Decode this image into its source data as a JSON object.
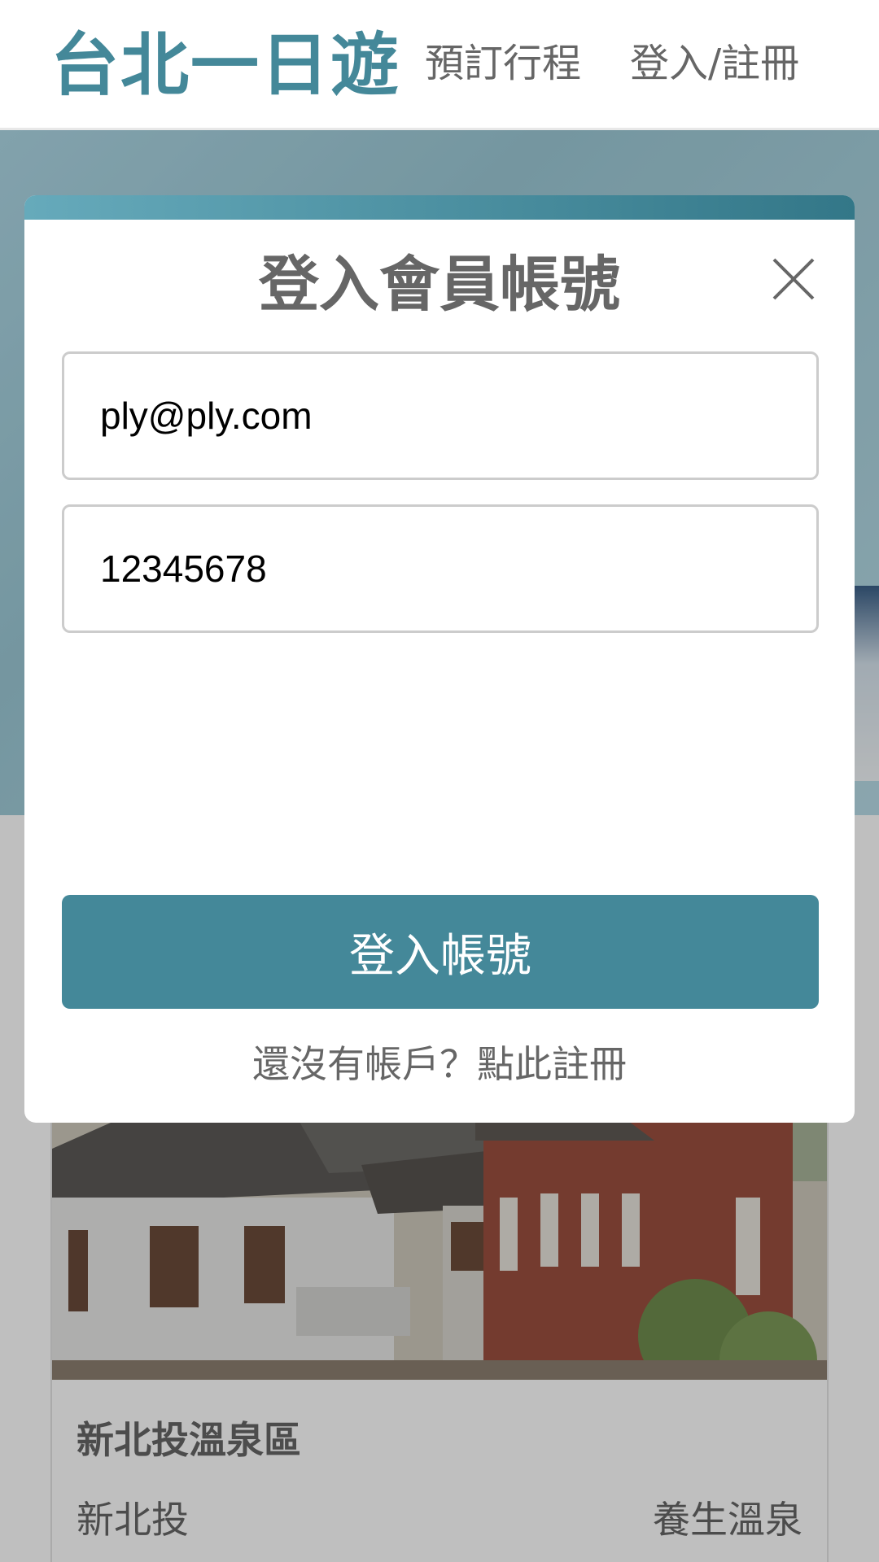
{
  "header": {
    "logo": "台北一日遊",
    "nav": {
      "booking": "預訂行程",
      "login": "登入/註冊"
    }
  },
  "modal": {
    "title": "登入會員帳號",
    "email_value": "ply@ply.com",
    "password_value": "12345678",
    "submit_label": "登入帳號",
    "register_prompt": "還沒有帳戶？",
    "register_link": "點此註冊"
  },
  "attraction_card": {
    "name": "新北投溫泉區",
    "mrt": "新北投",
    "category": "養生溫泉"
  },
  "colors": {
    "brand": "#448899",
    "text_gray": "#666666",
    "modal_bar_start": "#66aabb",
    "modal_bar_end": "#337788"
  },
  "icons": {
    "close": "close-icon"
  }
}
